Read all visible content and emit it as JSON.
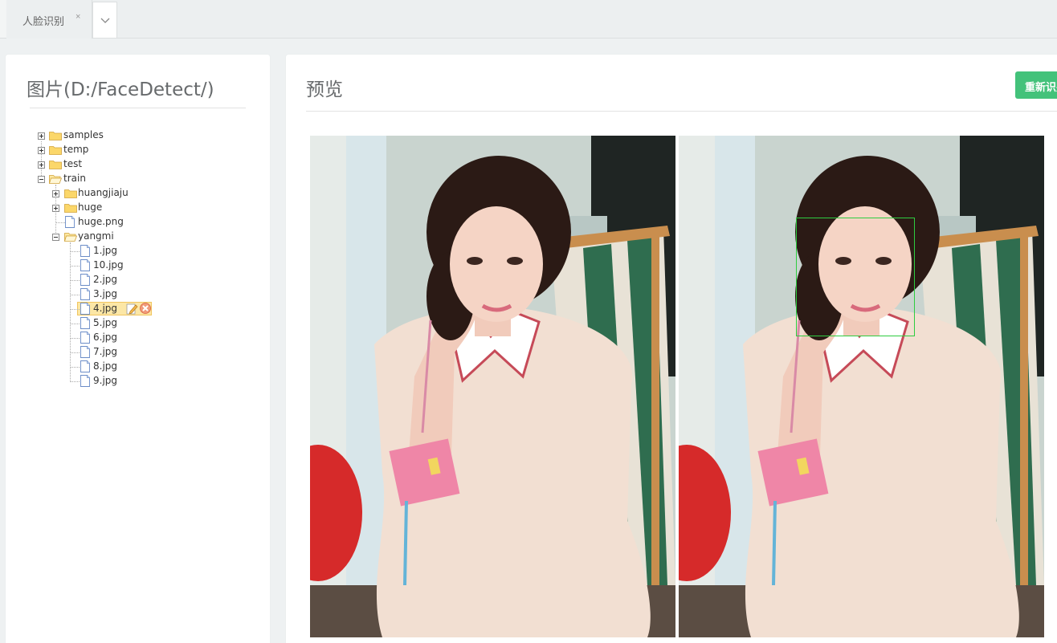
{
  "tabbar": {
    "tabs": [
      {
        "label": "人脸识别",
        "close": "×"
      }
    ]
  },
  "left_panel": {
    "title": "图片(D:/FaceDetect/)",
    "tree": {
      "samples": "samples",
      "temp": "temp",
      "test": "test",
      "train": "train",
      "huangjiaju": "huangjiaju",
      "huge": "huge",
      "huge_png": "huge.png",
      "yangmi": "yangmi",
      "files": [
        "1.jpg",
        "10.jpg",
        "2.jpg",
        "3.jpg",
        "4.jpg",
        "5.jpg",
        "6.jpg",
        "7.jpg",
        "8.jpg",
        "9.jpg"
      ],
      "selected_file": "4.jpg"
    }
  },
  "right_panel": {
    "title": "预览",
    "recognize_button": "重新识别",
    "images": {
      "original": "4.jpg",
      "detected": "4.jpg with face box"
    }
  },
  "colors": {
    "accent_green": "#43c27a",
    "face_box": "#2ecc40",
    "selection_bg": "#fce7a6"
  }
}
